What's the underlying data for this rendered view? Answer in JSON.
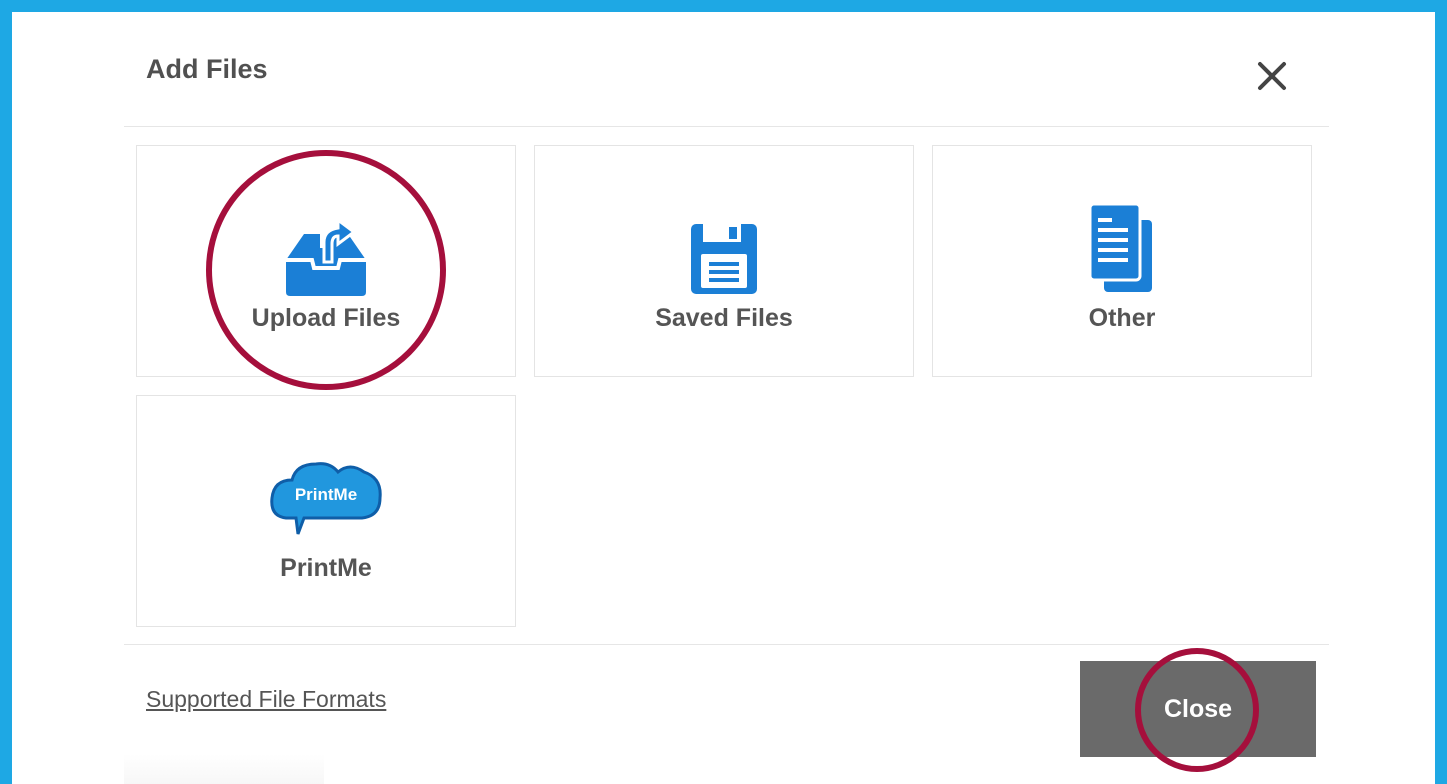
{
  "dialog": {
    "title": "Add Files",
    "close_icon": "close-icon"
  },
  "tiles": [
    {
      "label": "Upload Files",
      "icon": "upload-tray-icon"
    },
    {
      "label": "Saved Files",
      "icon": "floppy-disk-icon"
    },
    {
      "label": "Other",
      "icon": "documents-icon"
    },
    {
      "label": "PrintMe",
      "icon": "printme-cloud-icon",
      "icon_text": "PrintMe"
    }
  ],
  "footer": {
    "supported_formats_link": "Supported File Formats",
    "close_button": "Close"
  },
  "colors": {
    "frame_border": "#1ea8e4",
    "icon_blue": "#1b7fd6",
    "highlight": "#a50f3c",
    "close_button_bg": "#6a6a6a"
  }
}
